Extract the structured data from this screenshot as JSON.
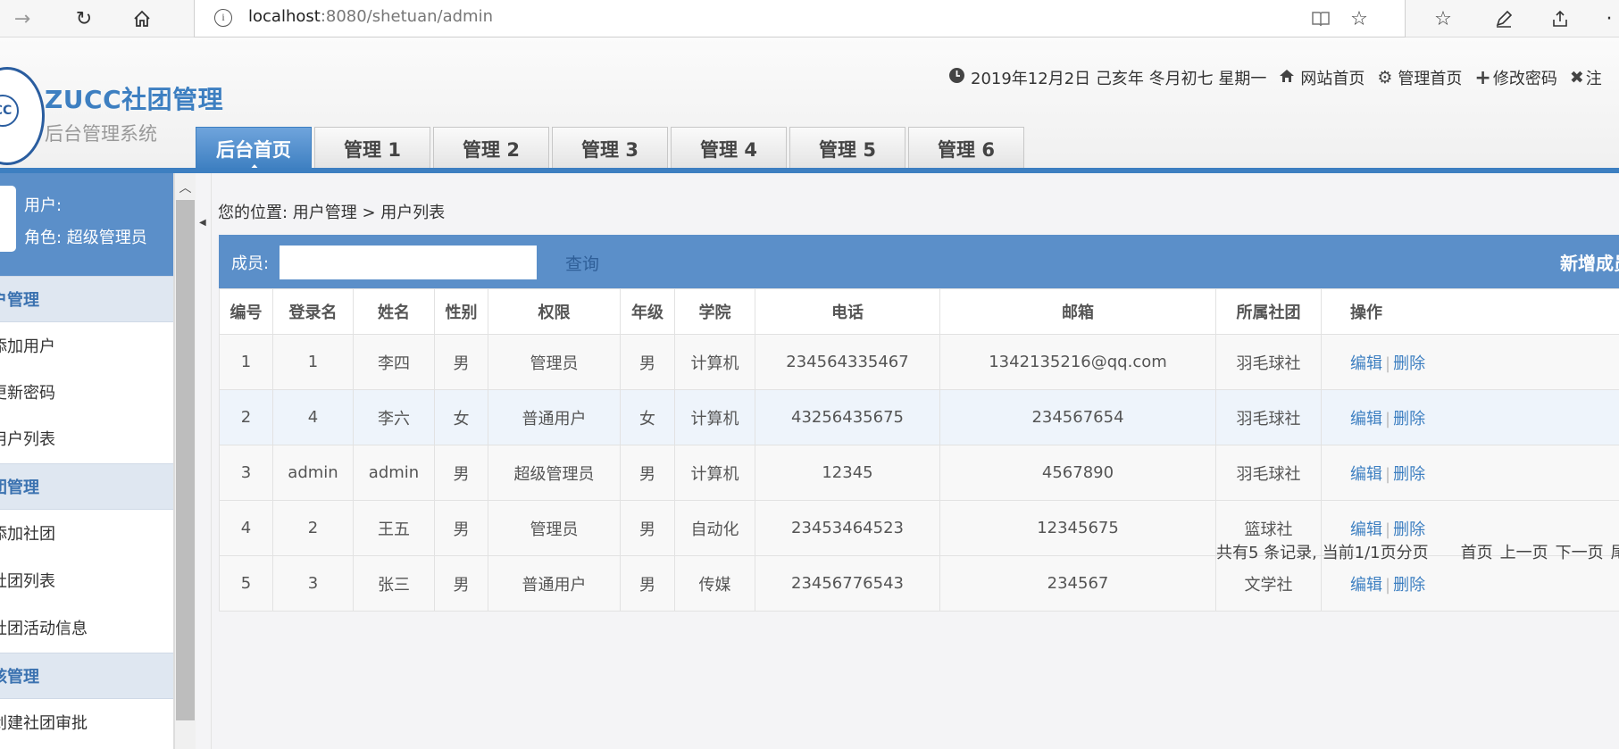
{
  "browser": {
    "url_host": "localhost",
    "url_rest": ":8080/shetuan/admin"
  },
  "header": {
    "brand_title": "ZUCC社团管理",
    "brand_subtitle": "后台管理系统",
    "logo_text": "CC",
    "date_text": "2019年12月2日 己亥年 冬月初七 星期一",
    "links": [
      "网站首页",
      "管理首页",
      "修改密码",
      "注"
    ],
    "tabs": [
      "后台首页",
      "管理 1",
      "管理 2",
      "管理 3",
      "管理 4",
      "管理 5",
      "管理 6"
    ],
    "active_tab": 0
  },
  "sidebar": {
    "user_label": "用户:",
    "role_label": "角色: 超级管理员",
    "groups": [
      {
        "title": "户管理",
        "items": [
          "添加用户",
          "更新密码",
          "用户列表"
        ]
      },
      {
        "title": "团管理",
        "items": [
          "添加社团",
          "社团列表",
          "社团活动信息"
        ]
      },
      {
        "title": "核管理",
        "items": [
          "创建社团审批"
        ]
      }
    ]
  },
  "main": {
    "breadcrumb": "您的位置: 用户管理 > 用户列表",
    "search_label": "成员:",
    "search_value": "",
    "search_button": "查询",
    "add_button": "新增成员",
    "columns": [
      "编号",
      "登录名",
      "姓名",
      "性别",
      "权限",
      "年级",
      "学院",
      "电话",
      "邮箱",
      "所属社团",
      "操作"
    ],
    "rows": [
      [
        "1",
        "1",
        "李四",
        "男",
        "管理员",
        "男",
        "计算机",
        "234564335467",
        "1342135216@qq.com",
        "羽毛球社"
      ],
      [
        "2",
        "4",
        "李六",
        "女",
        "普通用户",
        "女",
        "计算机",
        "43256435675",
        "234567654",
        "羽毛球社"
      ],
      [
        "3",
        "admin",
        "admin",
        "男",
        "超级管理员",
        "男",
        "计算机",
        "12345",
        "4567890",
        "羽毛球社"
      ],
      [
        "4",
        "2",
        "王五",
        "男",
        "管理员",
        "男",
        "自动化",
        "23453464523",
        "12345675",
        "篮球社"
      ],
      [
        "5",
        "3",
        "张三",
        "男",
        "普通用户",
        "男",
        "传媒",
        "23456776543",
        "234567",
        "文学社"
      ]
    ],
    "op_edit": "编辑",
    "op_delete": "删除",
    "pager_info": "共有5 条记录, 当前1/1页分页",
    "pager_links": [
      "首页",
      "上一页",
      "下一页",
      "尾"
    ]
  },
  "colors": {
    "accent": "#3d7fc1",
    "panel_blue": "#5b8fc9"
  }
}
